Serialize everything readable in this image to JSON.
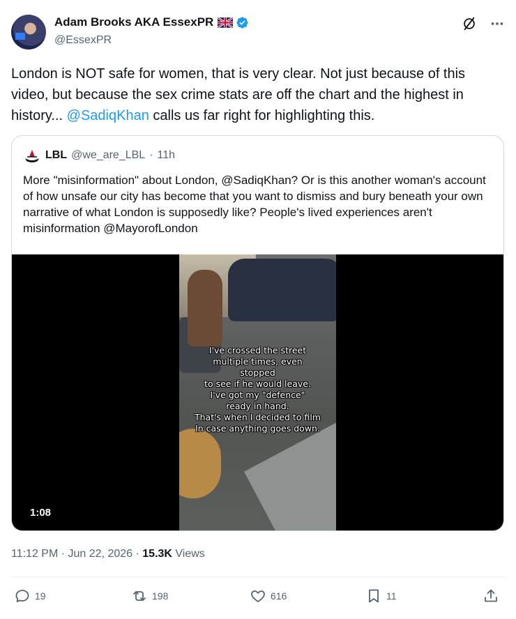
{
  "author": {
    "display_name": "Adam Brooks AKA EssexPR",
    "handle": "@EssexPR"
  },
  "icons": {
    "flag": "uk-flag-icon",
    "verified": "verified-badge-icon",
    "grok": "grok-icon",
    "more": "more-icon"
  },
  "tweet": {
    "text_1": "London is NOT safe for women, that is very clear. Not just because of this video, but because the sex crime stats are off the chart and the highest in history... ",
    "mention": "@SadiqKhan",
    "text_2": " calls us far right for highlighting this."
  },
  "quote": {
    "name": "LBL",
    "handle": "@we_are_LBL",
    "separator": "·",
    "time": "11h",
    "text": "More \"misinformation\" about London, @SadiqKhan? Or is this another woman's account of how unsafe our city has become that you want to dismiss and bury beneath your own narrative of what London is supposedly like? People's lived experiences aren't misinformation @MayorofLondon",
    "video": {
      "caption_lines": [
        "I've crossed the street",
        "multiple times, even",
        "stopped",
        "to see if he would leave.",
        "I've got my \"defence\"",
        "ready in hand.",
        "That's when I decided to film",
        "In case anything goes down."
      ],
      "duration": "1:08"
    }
  },
  "meta": {
    "time": "11:12 PM · Jun 22, 2026 · ",
    "views_count": "15.3K",
    "views_label": " Views"
  },
  "actions": {
    "replies": "19",
    "reposts": "198",
    "likes": "616",
    "bookmarks": "11"
  },
  "colors": {
    "accent": "#1d9bf0",
    "text": "#0f1419",
    "muted": "#536471",
    "border": "#cfd9de"
  }
}
